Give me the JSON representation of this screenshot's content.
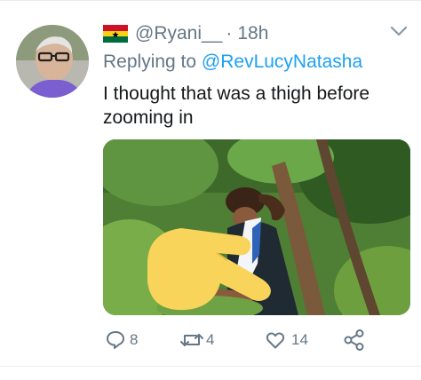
{
  "author": {
    "flag": "ghana-flag-icon",
    "handle": "@Ryani__",
    "separator": "·",
    "time": "18h"
  },
  "reply": {
    "prefix": "Replying to",
    "to": "@RevLucyNatasha"
  },
  "tweet": {
    "text": "I thought that was a thigh before zooming in"
  },
  "actions": {
    "replies": "8",
    "retweets": "4",
    "likes": "14"
  },
  "icons": [
    "chevron-down-icon",
    "reply-icon",
    "retweet-icon",
    "like-icon",
    "share-icon"
  ],
  "colors": {
    "muted": "#657786",
    "link": "#1da1f2",
    "text": "#14171a",
    "divider": "#e6ecf0",
    "overlay_hand": "#f9d45b"
  }
}
